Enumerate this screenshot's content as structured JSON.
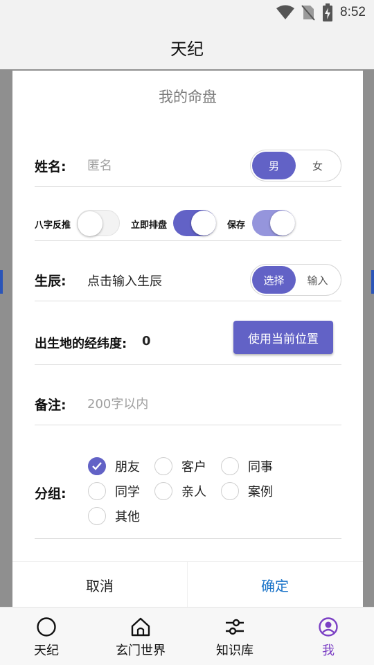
{
  "status_bar": {
    "time": "8:52"
  },
  "app_bar": {
    "title": "天纪"
  },
  "dialog": {
    "title": "我的命盘",
    "name": {
      "label": "姓名:",
      "placeholder": "匿名",
      "value": ""
    },
    "gender": {
      "options": [
        "男",
        "女"
      ],
      "selected": "男"
    },
    "switches": [
      {
        "label": "八字反推",
        "on": false
      },
      {
        "label": "立即排盘",
        "on": true
      },
      {
        "label": "保存",
        "on": true
      }
    ],
    "birth": {
      "label": "生辰:",
      "value": "点击输入生辰",
      "modes": [
        "选择",
        "输入"
      ],
      "selected_mode": "选择"
    },
    "geo": {
      "label": "出生地的经纬度:",
      "value": "0",
      "button": "使用当前位置"
    },
    "note": {
      "label": "备注:",
      "placeholder": "200字以内",
      "value": ""
    },
    "group": {
      "label": "分组:",
      "options": [
        "朋友",
        "客户",
        "同事",
        "同学",
        "亲人",
        "案例",
        "其他"
      ],
      "checked": [
        "朋友"
      ]
    },
    "footer": {
      "cancel": "取消",
      "confirm": "确定"
    }
  },
  "bottom_nav": {
    "items": [
      {
        "label": "天纪",
        "icon": "circle-icon"
      },
      {
        "label": "玄门世界",
        "icon": "home-icon"
      },
      {
        "label": "知识库",
        "icon": "sliders-icon"
      },
      {
        "label": "我",
        "icon": "user-icon"
      }
    ],
    "active": "我"
  },
  "colors": {
    "accent": "#6262c6",
    "accent_light": "#9595dc",
    "confirm_text": "#1a73c8",
    "nav_active": "#7b3fc4"
  }
}
